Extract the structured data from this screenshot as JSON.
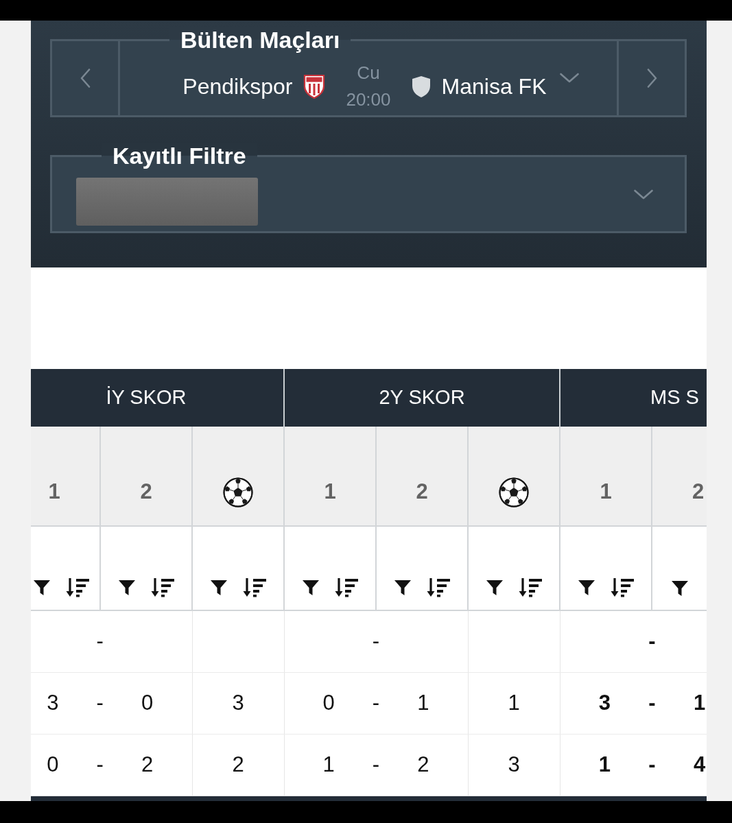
{
  "match_selector": {
    "title": "Bülten Maçları",
    "home_team": "Pendikspor",
    "day": "Cu",
    "time": "20:00",
    "away_team": "Manisa FK"
  },
  "saved_filter": {
    "title": "Kayıtlı Filtre"
  },
  "score_table": {
    "groups": [
      {
        "title": "İY SKOR",
        "bold_scores": false,
        "columns": [
          {
            "kind": "number",
            "label": "1"
          },
          {
            "kind": "number",
            "label": "2"
          },
          {
            "kind": "goals"
          }
        ]
      },
      {
        "title": "2Y SKOR",
        "bold_scores": false,
        "columns": [
          {
            "kind": "number",
            "label": "1"
          },
          {
            "kind": "number",
            "label": "2"
          },
          {
            "kind": "goals"
          }
        ]
      },
      {
        "title": "MS S",
        "bold_scores": true,
        "columns": [
          {
            "kind": "number",
            "label": "1"
          },
          {
            "kind": "number",
            "label": "2"
          }
        ]
      }
    ],
    "rows": [
      {
        "cells": [
          {
            "separator": "-"
          },
          {
            "separator": "-"
          },
          {
            "separator": "-"
          }
        ]
      },
      {
        "cells": [
          {
            "home": "3",
            "separator": "-",
            "away": "0",
            "total": "3"
          },
          {
            "home": "0",
            "separator": "-",
            "away": "1",
            "total": "1"
          },
          {
            "home": "3",
            "separator": "-",
            "away": "1"
          }
        ]
      },
      {
        "cells": [
          {
            "home": "0",
            "separator": "-",
            "away": "2",
            "total": "2"
          },
          {
            "home": "1",
            "separator": "-",
            "away": "2",
            "total": "3"
          },
          {
            "home": "1",
            "separator": "-",
            "away": "4"
          }
        ]
      }
    ]
  }
}
